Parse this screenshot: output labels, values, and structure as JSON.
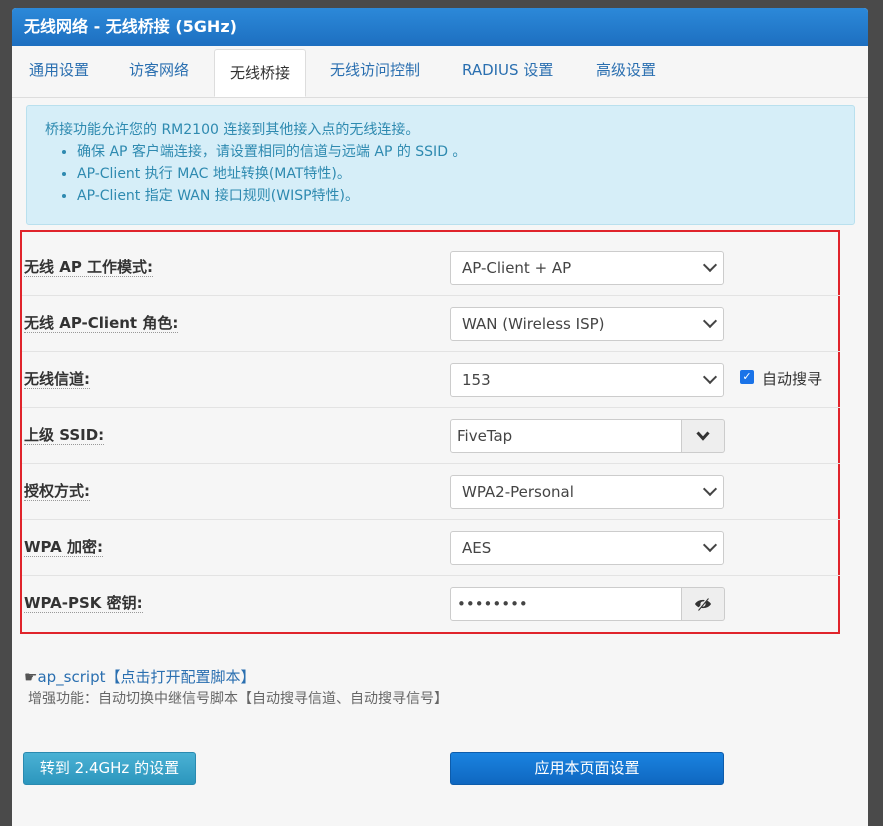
{
  "header": {
    "title": "无线网络 - 无线桥接 (5GHz)"
  },
  "tabs": [
    {
      "label": "通用设置"
    },
    {
      "label": "访客网络"
    },
    {
      "label": "无线桥接"
    },
    {
      "label": "无线访问控制"
    },
    {
      "label": "RADIUS 设置"
    },
    {
      "label": "高级设置"
    }
  ],
  "info": {
    "intro": "桥接功能允许您的 RM2100 连接到其他接入点的无线连接。",
    "bullets": [
      "确保 AP 客户端连接，请设置相同的信道与远端 AP 的 SSID 。",
      "AP-Client 执行 MAC 地址转换(MAT特性)。",
      "AP-Client 指定 WAN 接口规则(WISP特性)。"
    ]
  },
  "form": {
    "ap_mode": {
      "label": "无线 AP 工作模式:",
      "value": "AP-Client + AP"
    },
    "client_role": {
      "label": "无线 AP-Client 角色:",
      "value": "WAN (Wireless ISP)"
    },
    "channel": {
      "label": "无线信道:",
      "value": "153",
      "auto_label": "自动搜寻",
      "auto_checked": true
    },
    "ssid": {
      "label": "上级 SSID:",
      "value": "FiveTap"
    },
    "auth": {
      "label": "授权方式:",
      "value": "WPA2-Personal"
    },
    "encryption": {
      "label": "WPA 加密:",
      "value": "AES"
    },
    "psk": {
      "label": "WPA-PSK 密钥:",
      "value": "••••••••"
    }
  },
  "script": {
    "link": "ap_script【点击打开配置脚本】",
    "desc": "增强功能：自动切换中继信号脚本【自动搜寻信道、自动搜寻信号】"
  },
  "buttons": {
    "goto24": "转到 2.4GHz 的设置",
    "apply": "应用本页面设置"
  },
  "colors": {
    "accent": "#1a73d9",
    "highlight_border": "#e0242b"
  }
}
